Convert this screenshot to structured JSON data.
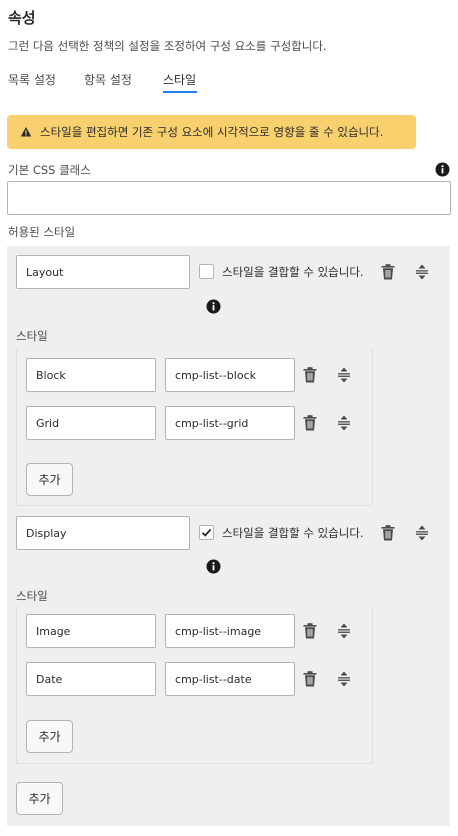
{
  "header": {
    "title": "속성",
    "description": "그런 다음 선택한 정책의 설정을 조정하여 구성 요소를 구성합니다."
  },
  "tabs": [
    {
      "label": "목록 설정",
      "active": false
    },
    {
      "label": "항목 설정",
      "active": false
    },
    {
      "label": "스타일",
      "active": true
    }
  ],
  "alert": {
    "text": "스타일을 편집하면 기존 구성 요소에 시각적으로 영향을 줄 수 있습니다.",
    "color": "#f9d06e"
  },
  "base_css": {
    "label": "기본 CSS 클래스",
    "value": ""
  },
  "allowed_styles": {
    "label": "허용된 스타일",
    "groups": [
      {
        "name": "Layout",
        "combine_label": "스타일을 결합할 수 있습니다.",
        "combine_checked": false,
        "styles_label": "스타일",
        "styles": [
          {
            "name": "Block",
            "class": "cmp-list--block"
          },
          {
            "name": "Grid",
            "class": "cmp-list--grid"
          }
        ],
        "add_label": "추가"
      },
      {
        "name": "Display",
        "combine_label": "스타일을 결합할 수 있습니다.",
        "combine_checked": true,
        "styles_label": "스타일",
        "styles": [
          {
            "name": "Image",
            "class": "cmp-list--image"
          },
          {
            "name": "Date",
            "class": "cmp-list--date"
          }
        ],
        "add_label": "추가"
      }
    ],
    "add_label": "추가"
  },
  "colors": {
    "accent": "#2680eb",
    "warning": "#f9d06e",
    "panel": "#efefef"
  }
}
